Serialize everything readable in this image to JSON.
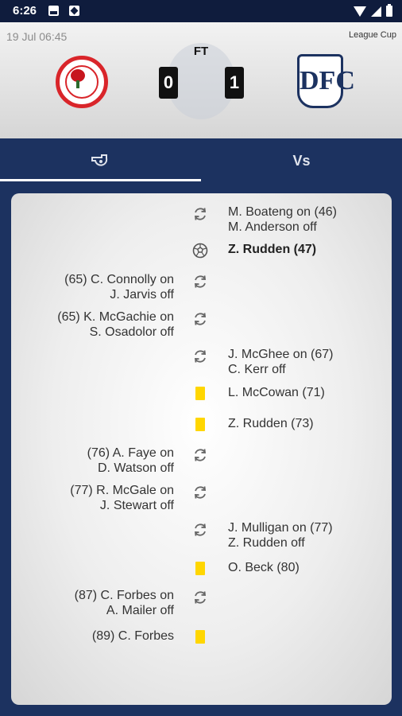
{
  "status_bar": {
    "time": "6:26"
  },
  "match": {
    "date": "19 Jul 06:45",
    "competition": "League Cup",
    "status": "FT",
    "home_score": "0",
    "away_score": "1",
    "home_crest_icon": "bonnyrigg-rose-crest",
    "away_crest_icon": "dundee-fc-crest",
    "away_crest_monogram": "DFC"
  },
  "tabs": {
    "events_icon": "whistle-icon",
    "vs_label": "Vs",
    "active": "events"
  },
  "colors": {
    "primary": "#1c3260",
    "yellow_card": "#ffd600",
    "home_red": "#d9252a"
  },
  "events": [
    {
      "side": "away",
      "type": "substitution",
      "line1": "M. Boateng on (46)",
      "line2": "M. Anderson off"
    },
    {
      "side": "away",
      "type": "goal",
      "line1": "Z. Rudden (47)",
      "line2": ""
    },
    {
      "side": "home",
      "type": "substitution",
      "line1": "(65) C. Connolly on",
      "line2": "J. Jarvis off"
    },
    {
      "side": "home",
      "type": "substitution",
      "line1": "(65) K. McGachie on",
      "line2": "S. Osadolor off"
    },
    {
      "side": "away",
      "type": "substitution",
      "line1": "J. McGhee on (67)",
      "line2": "C. Kerr off"
    },
    {
      "side": "away",
      "type": "yellow-card",
      "line1": "L. McCowan (71)",
      "line2": ""
    },
    {
      "side": "away",
      "type": "yellow-card",
      "line1": "Z. Rudden (73)",
      "line2": ""
    },
    {
      "side": "home",
      "type": "substitution",
      "line1": "(76) A. Faye on",
      "line2": "D. Watson off"
    },
    {
      "side": "home",
      "type": "substitution",
      "line1": "(77) R. McGale on",
      "line2": "J. Stewart off"
    },
    {
      "side": "away",
      "type": "substitution",
      "line1": "J. Mulligan on (77)",
      "line2": "Z. Rudden off"
    },
    {
      "side": "away",
      "type": "yellow-card",
      "line1": "O. Beck (80)",
      "line2": ""
    },
    {
      "side": "home",
      "type": "substitution",
      "line1": "(87) C. Forbes on",
      "line2": "A. Mailer off"
    },
    {
      "side": "home",
      "type": "yellow-card",
      "line1": "(89) C. Forbes",
      "line2": ""
    }
  ]
}
